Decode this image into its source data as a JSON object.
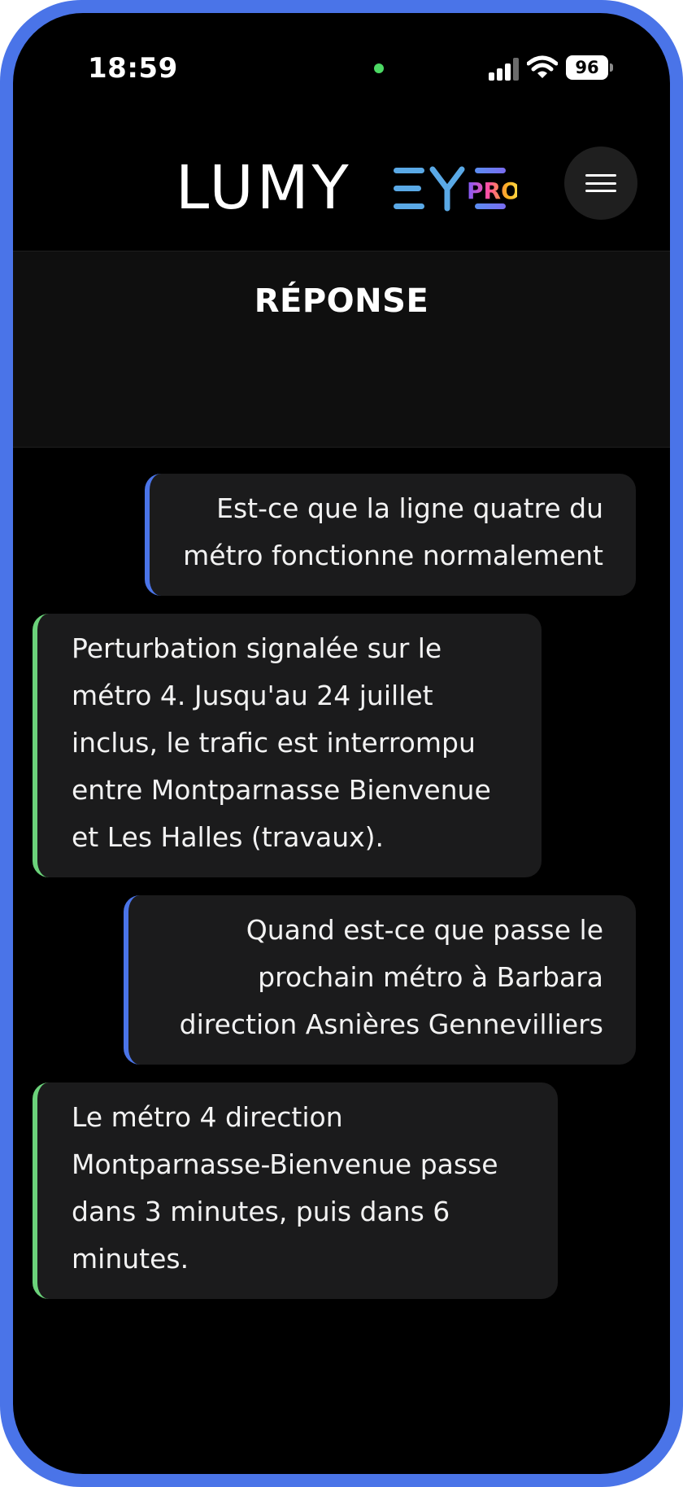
{
  "status_bar": {
    "time": "18:59",
    "battery": "96",
    "dot_color": "#4cd964"
  },
  "header": {
    "logo_icon": "lumyeye-pro-logo",
    "logo_text_lumy": "LUMY",
    "logo_text_pro": "PRO",
    "menu_icon": "hamburger-menu-icon"
  },
  "section": {
    "title": "RÉPONSE"
  },
  "conversation": {
    "messages": [
      {
        "role": "user",
        "text": "Est-ce que la ligne quatre du métro fonctionne normalement"
      },
      {
        "role": "assistant",
        "text": "Perturbation signalée sur le métro 4. Jusqu'au 24 juillet inclus, le trafic est interrompu entre Montparnasse Bienvenue et Les Halles (travaux)."
      },
      {
        "role": "user",
        "text": "Quand est-ce que passe le prochain métro à Barbara direction Asnières Gennevilliers"
      },
      {
        "role": "assistant",
        "text": "Le métro 4 direction Montparnasse-Bienvenue passe dans 3 minutes, puis dans 6 minutes."
      }
    ]
  },
  "colors": {
    "device_frame": "#4a74e8",
    "user_accent": "#4a74e8",
    "assistant_accent": "#6bd27a",
    "bubble_bg": "#1b1b1c",
    "logo_eye_blue": "#5aa9e6"
  }
}
